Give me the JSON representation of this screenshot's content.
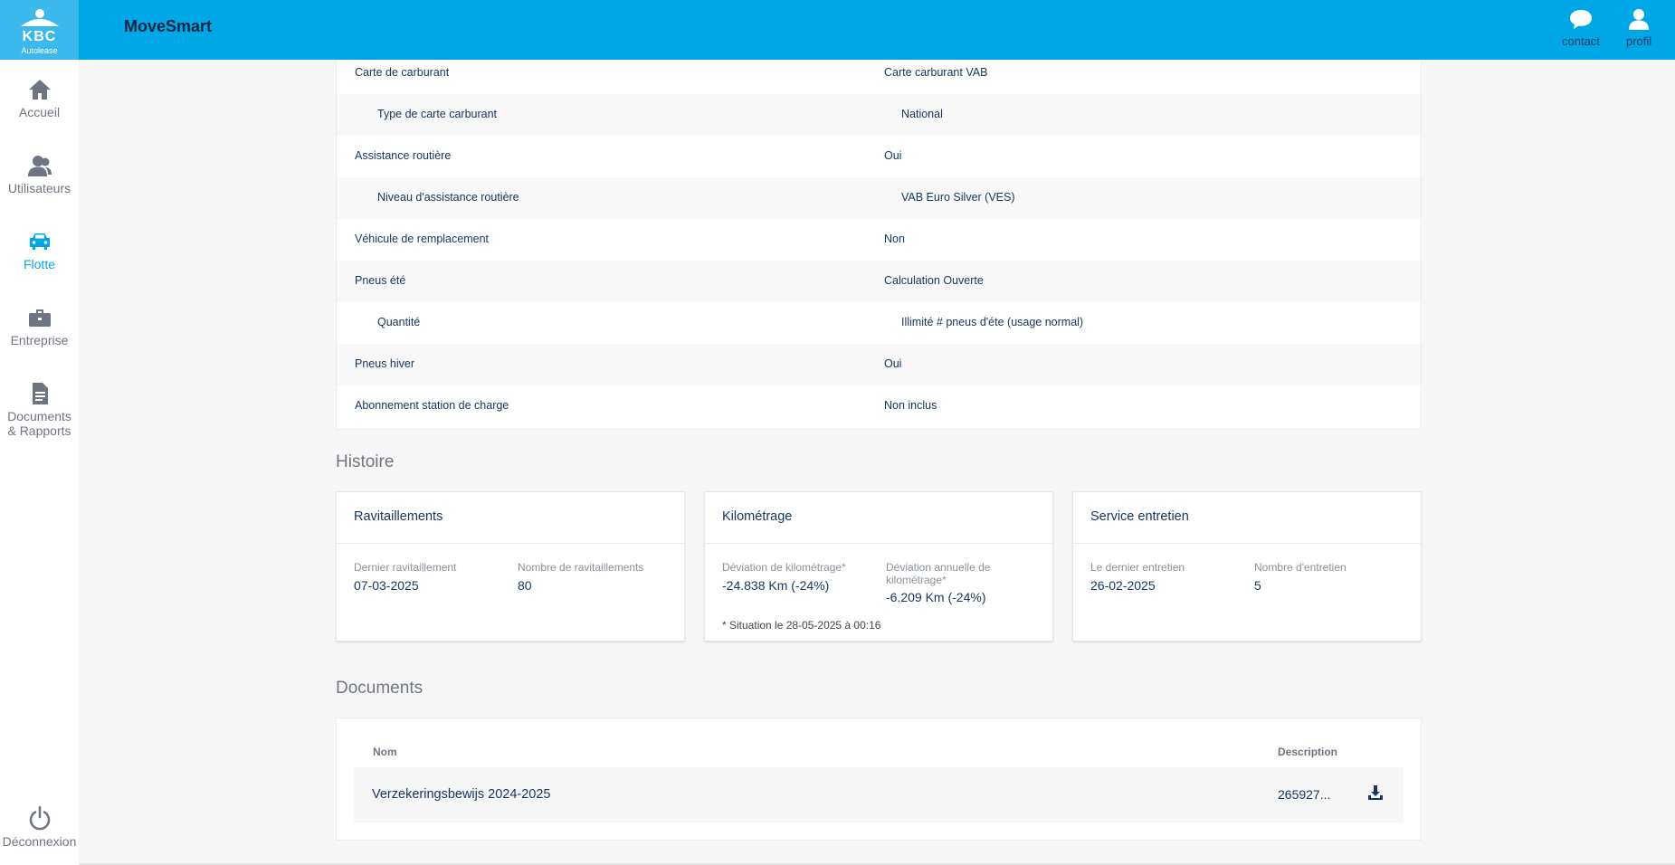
{
  "header": {
    "logo_text": "KBC",
    "logo_sub": "Autolease",
    "app_title": "MoveSmart",
    "actions": {
      "contact": "contact",
      "profile": "profil"
    }
  },
  "sidebar": {
    "items": [
      {
        "label": "Accueil",
        "icon": "home-icon"
      },
      {
        "label": "Utilisateurs",
        "icon": "users-icon"
      },
      {
        "label": "Flotte",
        "icon": "car-icon",
        "active": true
      },
      {
        "label": "Entreprise",
        "icon": "briefcase-icon"
      },
      {
        "label": "Documents & Rapports",
        "icon": "document-icon"
      }
    ],
    "logout": {
      "label": "Déconnexion",
      "icon": "power-icon"
    }
  },
  "details": [
    {
      "key": "Carte de carburant",
      "value": "Carte carburant VAB",
      "sub": false
    },
    {
      "key": "Type de carte carburant",
      "value": "National",
      "sub": true
    },
    {
      "key": "Assistance routière",
      "value": "Oui",
      "sub": false
    },
    {
      "key": "Niveau d'assistance routière",
      "value": "VAB Euro Silver (VES)",
      "sub": true
    },
    {
      "key": "Véhicule de remplacement",
      "value": "Non",
      "sub": false
    },
    {
      "key": "Pneus été",
      "value": "Calculation Ouverte",
      "sub": false
    },
    {
      "key": "Quantité",
      "value": "Illimité # pneus d'éte (usage normal)",
      "sub": true
    },
    {
      "key": "Pneus hiver",
      "value": "Oui",
      "sub": false
    },
    {
      "key": "Abonnement station de charge",
      "value": "Non inclus",
      "sub": false
    }
  ],
  "history": {
    "title": "Histoire",
    "cards": [
      {
        "title": "Ravitaillements",
        "stat1_label": "Dernier ravitaillement",
        "stat1_value": "07-03-2025",
        "stat2_label": "Nombre de ravitaillements",
        "stat2_value": "80",
        "note": ""
      },
      {
        "title": "Kilométrage",
        "stat1_label": "Déviation de kilométrage*",
        "stat1_value": "-24.838 Km (-24%)",
        "stat2_label": "Déviation annuelle de kilométrage*",
        "stat2_value": "-6.209 Km (-24%)",
        "note": "* Situation le 28-05-2025 à 00:16"
      },
      {
        "title": "Service entretien",
        "stat1_label": "Le dernier entretien",
        "stat1_value": "26-02-2025",
        "stat2_label": "Nombre d'entretien",
        "stat2_value": "5",
        "note": ""
      }
    ]
  },
  "documents": {
    "title": "Documents",
    "col_name": "Nom",
    "col_description": "Description",
    "rows": [
      {
        "name": "Verzekeringsbewijs 2024-2025",
        "description": "265927...",
        "icon": "download-icon"
      }
    ]
  },
  "colors": {
    "header": "#00a7e7",
    "accent": "#00a7e7",
    "text": "#14365f",
    "background": "#f7f7f7"
  }
}
